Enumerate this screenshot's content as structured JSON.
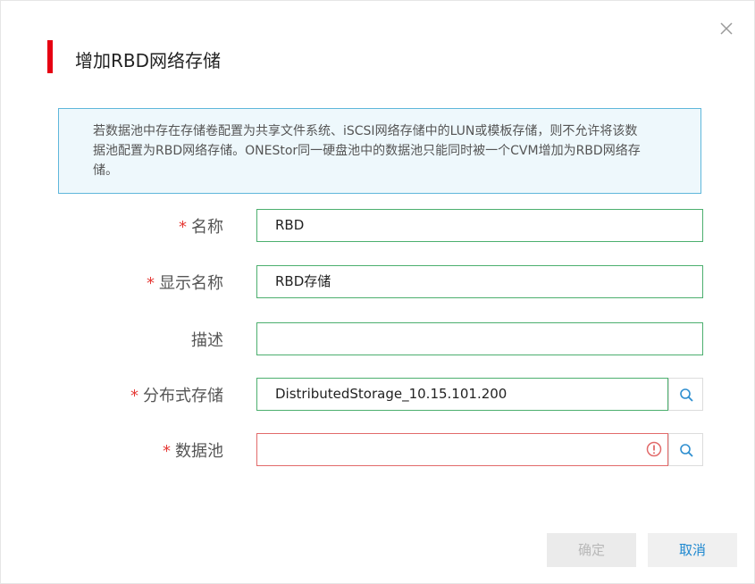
{
  "dialog": {
    "title": "增加RBD网络存储",
    "notice": "若数据池中存在存储卷配置为共享文件系统、iSCSI网络存储中的LUN或模板存储，则不允许将该数据池配置为RBD网络存储。ONEStor同一硬盘池中的数据池只能同时被一个CVM增加为RBD网络存储。"
  },
  "form": {
    "required_mark": "*",
    "name": {
      "label": "名称",
      "value": "RBD"
    },
    "display_name": {
      "label": "显示名称",
      "value": "RBD存储"
    },
    "description": {
      "label": "描述",
      "value": ""
    },
    "distributed_storage": {
      "label": "分布式存储",
      "value": "DistributedStorage_10.15.101.200"
    },
    "data_pool": {
      "label": "数据池",
      "value": ""
    }
  },
  "buttons": {
    "ok": "确定",
    "cancel": "取消"
  },
  "colors": {
    "accent": "#e60012",
    "notice_border": "#5fb7db",
    "valid_border": "#4caf6e",
    "error_border": "#e26a6a",
    "link_blue": "#1e88d0"
  },
  "icons": [
    "close-icon",
    "search-icon",
    "error-icon"
  ]
}
